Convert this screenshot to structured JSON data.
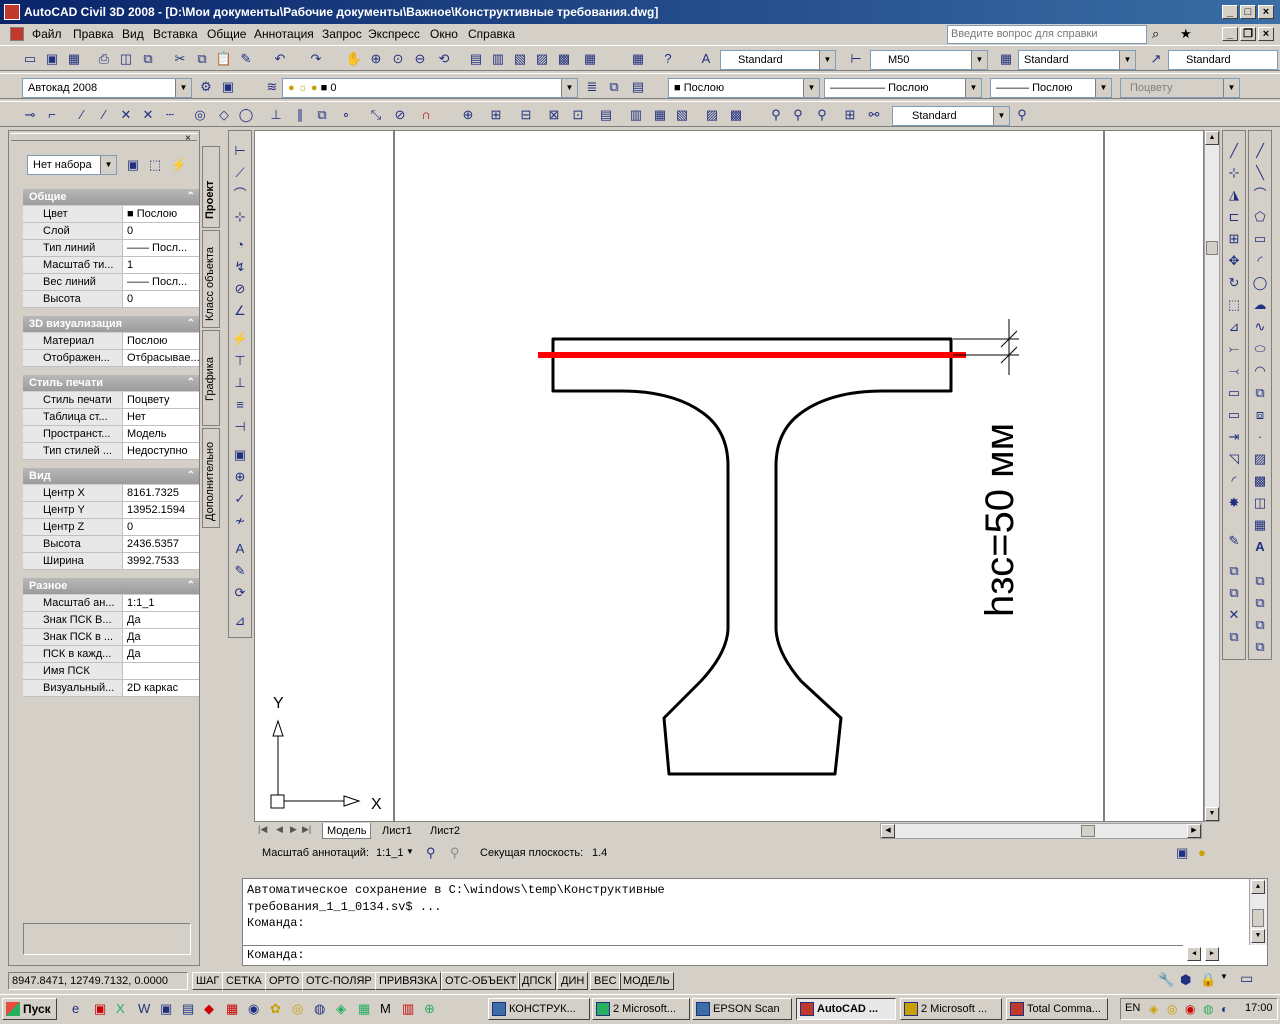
{
  "window": {
    "title": "AutoCAD Civil 3D 2008 - [D:\\Мои документы\\Рабочие документы\\Важное\\Конструктивные требования.dwg]",
    "minimize": "_",
    "maximize": "□",
    "close": "×"
  },
  "menu": {
    "items": [
      "Файл",
      "Правка",
      "Вид",
      "Вставка",
      "Общие",
      "Аннотация",
      "Запрос",
      "Экспресс",
      "Окно",
      "Справка"
    ],
    "help_placeholder": "Введите вопрос для справки"
  },
  "toolbar1": {
    "text_style": "Standard",
    "dim_style": "M50",
    "table_style": "Standard",
    "mleader_style": "Standard"
  },
  "toolbar2": {
    "workspace": "Автокад 2008",
    "layer": "0",
    "color": "Послою",
    "linetype": "Послою",
    "lineweight": "Послою",
    "plotstyle": "Поцвету"
  },
  "toolbar3": {
    "dim_style": "Standard"
  },
  "palette": {
    "selection": "Нет набора",
    "tabs": [
      "Проект",
      "Класс объекта",
      "Графика",
      "Дополнительно"
    ],
    "sections": [
      {
        "title": "Общие",
        "rows": [
          [
            "Цвет",
            "■ Послою"
          ],
          [
            "Слой",
            "0"
          ],
          [
            "Тип линий",
            "—— Посл..."
          ],
          [
            "Масштаб ти...",
            "1"
          ],
          [
            "Вес линий",
            "—— Посл..."
          ],
          [
            "Высота",
            "0"
          ]
        ]
      },
      {
        "title": "3D визуализация",
        "rows": [
          [
            "Материал",
            "Послою"
          ],
          [
            "Отображен...",
            "Отбрасывае..."
          ]
        ]
      },
      {
        "title": "Стиль печати",
        "rows": [
          [
            "Стиль печати",
            "Поцвету"
          ],
          [
            "Таблица ст...",
            "Нет"
          ],
          [
            "Пространст...",
            "Модель"
          ],
          [
            "Тип стилей ...",
            "Недоступно"
          ]
        ]
      },
      {
        "title": "Вид",
        "rows": [
          [
            "Центр X",
            "8161.7325"
          ],
          [
            "Центр Y",
            "13952.1594"
          ],
          [
            "Центр Z",
            "0"
          ],
          [
            "Высота",
            "2436.5357"
          ],
          [
            "Ширина",
            "3992.7533"
          ]
        ]
      },
      {
        "title": "Разное",
        "rows": [
          [
            "Масштаб ан...",
            "1:1_1"
          ],
          [
            "Знак ПСК В...",
            "Да"
          ],
          [
            "Знак ПСК в ...",
            "Да"
          ],
          [
            "ПСК в кажд...",
            "Да"
          ],
          [
            "Имя ПСК",
            ""
          ],
          [
            "Визуальный...",
            "2D каркас"
          ]
        ]
      }
    ]
  },
  "drawing": {
    "dimension_text": "hзс=50 мм",
    "ucs_x": "X",
    "ucs_y": "Y",
    "accent_color": "#ff0000"
  },
  "layout_tabs": [
    "Модель",
    "Лист1",
    "Лист2"
  ],
  "annotation": {
    "scale_label": "Масштаб аннотаций:",
    "scale_value": "1:1_1",
    "section_label": "Секущая плоскость:",
    "section_value": "1.4"
  },
  "command": {
    "line1": "Автоматическое сохранение в C:\\windows\\temp\\Конструктивные",
    "line2": "требования_1_1_0134.sv$ ...",
    "line3": "Команда:",
    "prompt": "Команда:"
  },
  "status": {
    "coords": "8947.8471, 12749.7132, 0.0000",
    "buttons": [
      "ШАГ",
      "СЕТКА",
      "ОРТО",
      "ОТС-ПОЛЯР",
      "ПРИВЯЗКА",
      "ОТС-ОБЪЕКТ",
      "ДПСК",
      "ДИН",
      "ВЕС",
      "МОДЕЛЬ"
    ]
  },
  "taskbar": {
    "start": "Пуск",
    "tasks": [
      "КОНСТРУК...",
      "2 Microsoft...",
      "EPSON Scan",
      "AutoCAD ...",
      "2 Microsoft ...",
      "Total Comma..."
    ],
    "lang": "EN",
    "clock": "17:00"
  }
}
